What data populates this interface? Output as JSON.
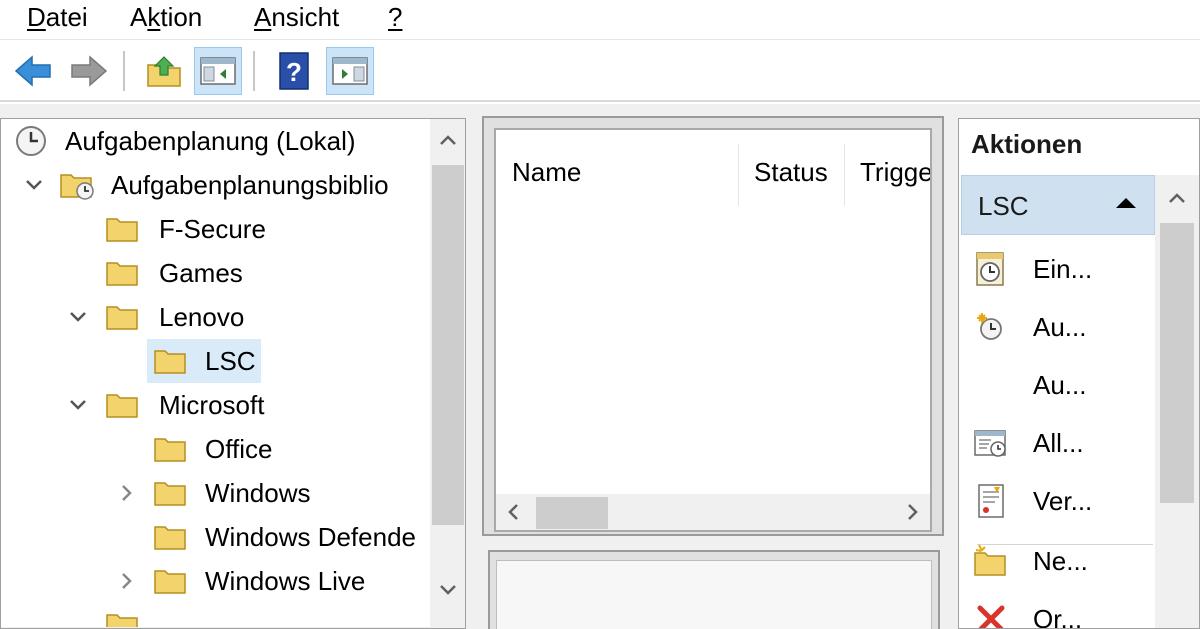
{
  "menubar": {
    "items": [
      {
        "pre": "",
        "ul": "D",
        "post": "atei"
      },
      {
        "pre": "A",
        "ul": "k",
        "post": "tion"
      },
      {
        "pre": "",
        "ul": "A",
        "post": "nsicht"
      },
      {
        "pre": "",
        "ul": "?",
        "post": ""
      }
    ]
  },
  "toolbar": {
    "buttons": [
      "back-arrow-icon",
      "forward-arrow-icon",
      "folder-up-icon",
      "show-hide-console-tree-icon",
      "help-icon",
      "show-hide-action-pane-icon"
    ]
  },
  "tree": {
    "items": [
      {
        "label": "Aufgabenplanung (Lokal)",
        "icon": "clock-icon",
        "expanded": null
      },
      {
        "label": "Aufgabenplanungsbiblio",
        "icon": "folder-clock-icon",
        "expanded": true
      },
      {
        "label": "F-Secure",
        "icon": "folder-icon",
        "expanded": null
      },
      {
        "label": "Games",
        "icon": "folder-icon",
        "expanded": null
      },
      {
        "label": "Lenovo",
        "icon": "folder-icon",
        "expanded": true
      },
      {
        "label": "LSC",
        "icon": "folder-icon",
        "expanded": null,
        "selected": true
      },
      {
        "label": "Microsoft",
        "icon": "folder-icon",
        "expanded": true
      },
      {
        "label": "Office",
        "icon": "folder-icon",
        "expanded": null
      },
      {
        "label": "Windows",
        "icon": "folder-icon",
        "expanded": false
      },
      {
        "label": "Windows Defende",
        "icon": "folder-icon",
        "expanded": null
      },
      {
        "label": "Windows Live",
        "icon": "folder-icon",
        "expanded": false
      }
    ]
  },
  "task_list": {
    "columns": [
      "Name",
      "Status",
      "Trigge"
    ]
  },
  "actions": {
    "title": "Aktionen",
    "group_label": "LSC",
    "items": [
      {
        "label": "Ein...",
        "icon": "create-basic-task-icon"
      },
      {
        "label": "Au...",
        "icon": "create-task-icon"
      },
      {
        "label": "Au...",
        "icon": ""
      },
      {
        "label": "All...",
        "icon": "display-all-running-tasks-icon"
      },
      {
        "label": "Ver...",
        "icon": "enable-history-icon"
      },
      {
        "label": "Ne...",
        "icon": "new-folder-icon"
      },
      {
        "label": "Or...",
        "icon": "delete-folder-icon"
      }
    ]
  },
  "colors": {
    "selection": "#d9ebf9",
    "actions_group_bg": "#cfe0f0",
    "toolbar_pressed": "#cce4f7",
    "folder_yellow": "#f3d36b",
    "back_arrow_blue": "#3a8fd9"
  }
}
